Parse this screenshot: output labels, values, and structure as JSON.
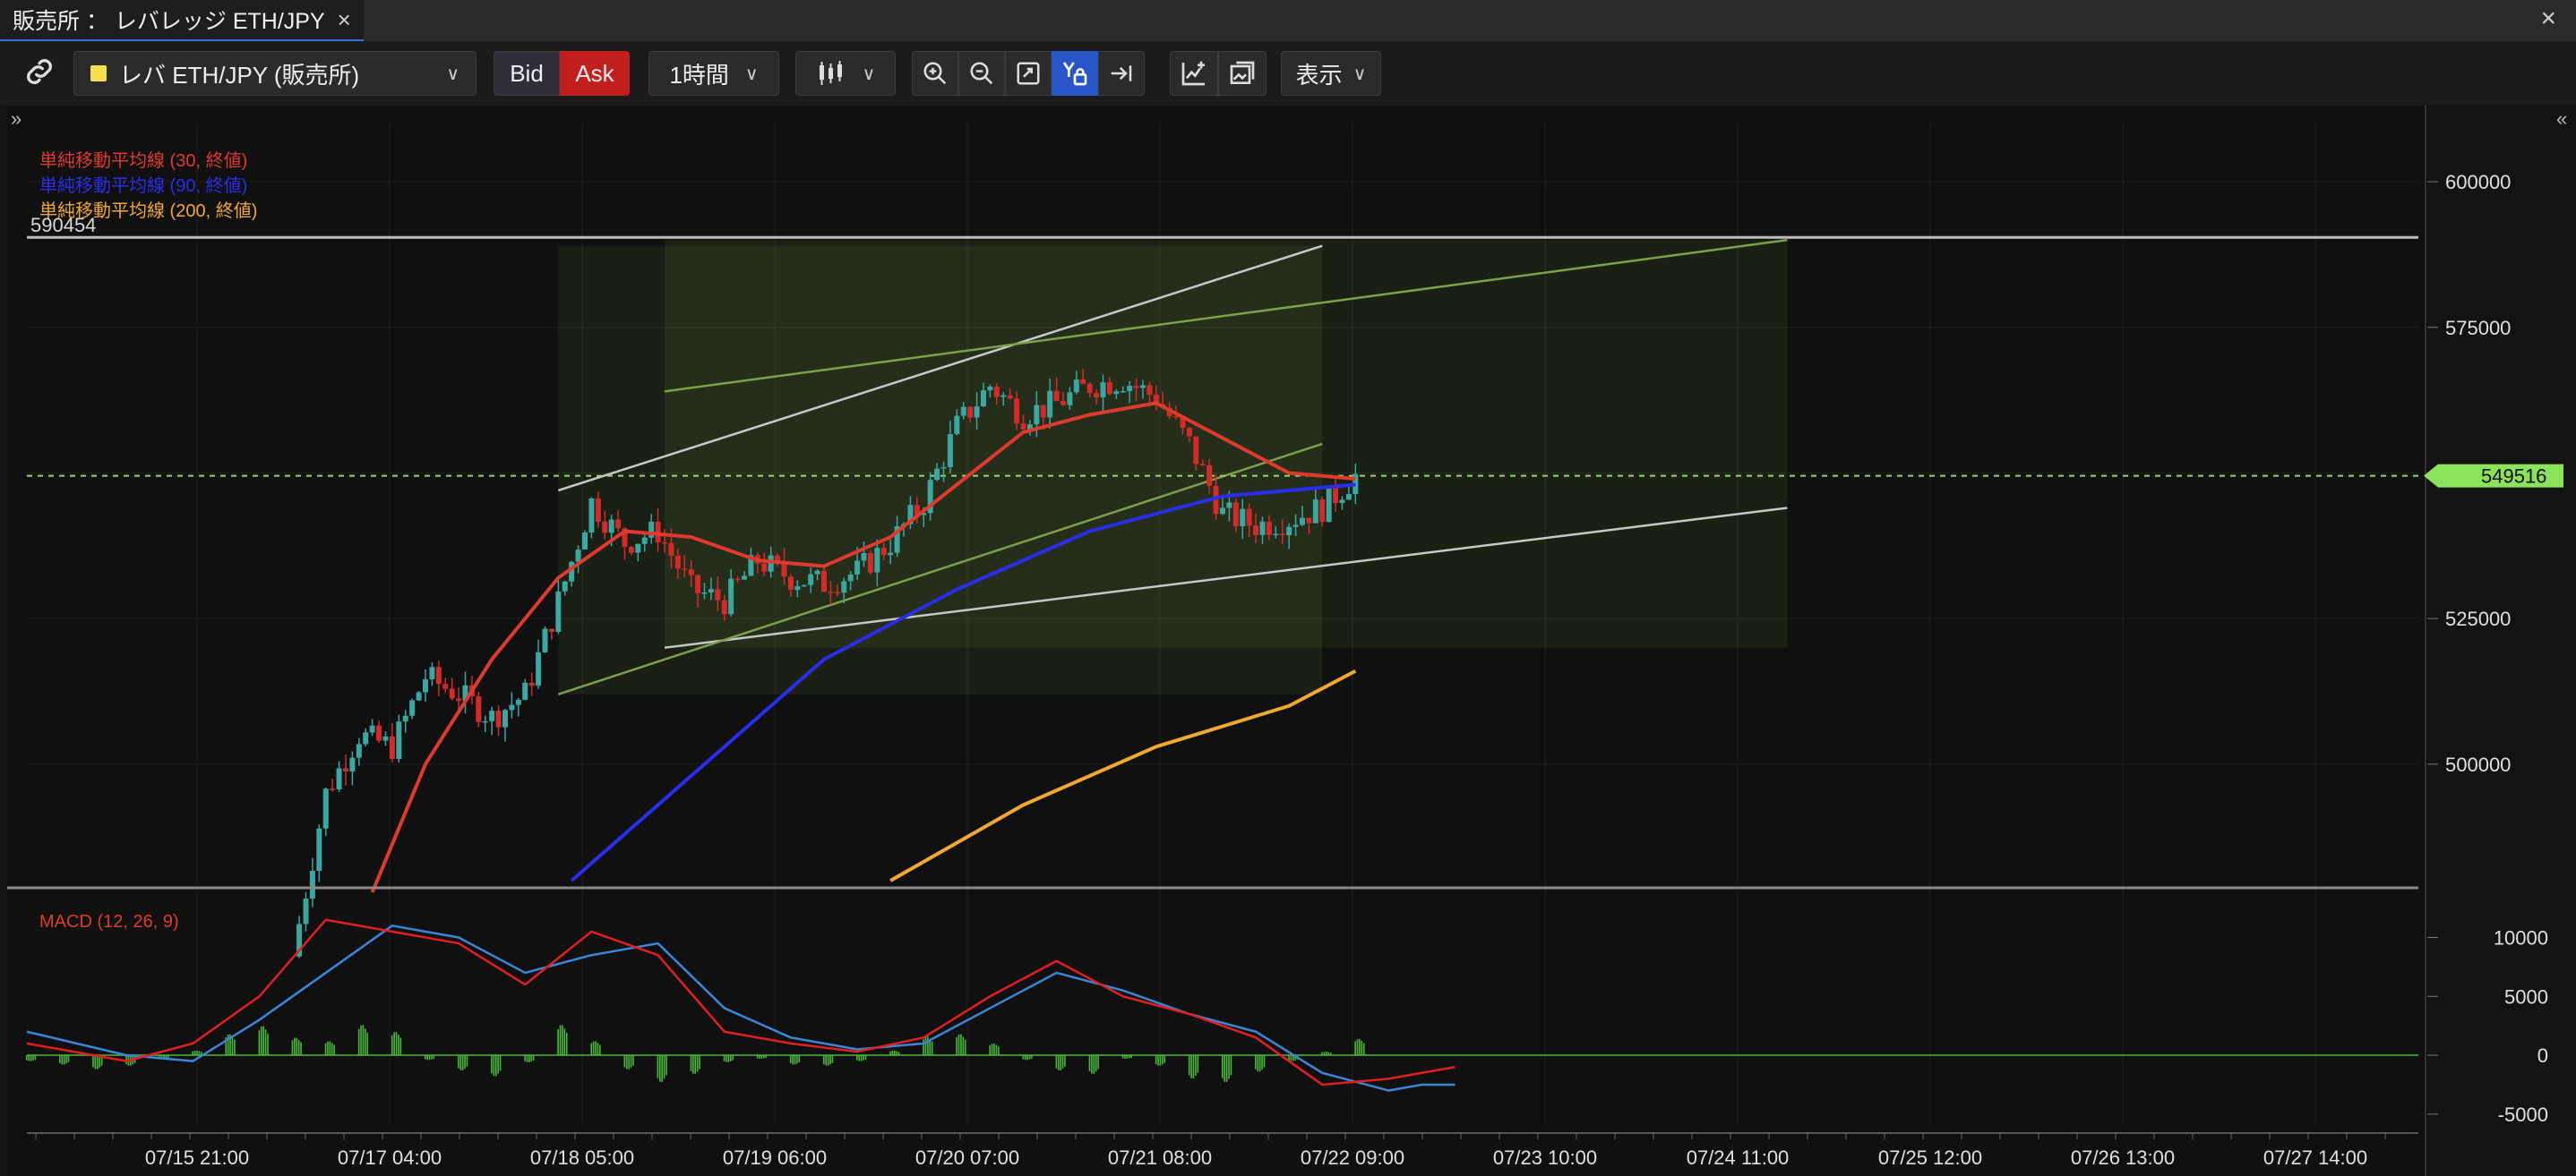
{
  "window": {
    "tab_title": "販売所 ： レバレッジ ETH/JPY",
    "tab_close": "×",
    "window_close": "×"
  },
  "toolbar": {
    "link_icon": "link-icon",
    "symbol_label": "レバ ETH/JPY (販売所)",
    "symbol_color": "#f5e050",
    "bid_label": "Bid",
    "ask_label": "Ask",
    "interval_label": "1時間",
    "chart_type_icon": "candlestick-icon",
    "zoom_in_icon": "zoom-in-icon",
    "zoom_out_icon": "zoom-out-icon",
    "fit_icon": "fit-screen-icon",
    "y_lock_icon": "y-lock-icon",
    "scroll_latest_icon": "scroll-to-latest-icon",
    "add_indicator_icon": "add-indicator-icon",
    "screenshot_icon": "screenshot-icon",
    "view_label": "表示",
    "left_expand": "»",
    "right_expand": "«"
  },
  "chart_data": [
    {
      "type": "candlestick",
      "legend": [
        {
          "name": "単純移動平均線 (30, 終値)",
          "color": "#e03a2f"
        },
        {
          "name": "単純移動平均線 (90, 終値)",
          "color": "#2a2ee8"
        },
        {
          "name": "単純移動平均線 (200, 終値)",
          "color": "#f0a830"
        }
      ],
      "yticks": [
        600000,
        575000,
        550000,
        525000,
        500000
      ],
      "ytick_labels": [
        "600000",
        "575000",
        "525000",
        "500000"
      ],
      "ylim": [
        480000,
        610000
      ],
      "xtick_labels": [
        "07/15 21:00",
        "07/17 04:00",
        "07/18 05:00",
        "07/19 06:00",
        "07/20 07:00",
        "07/21 08:00",
        "07/22 09:00",
        "07/23 10:00",
        "07/24 11:00",
        "07/25 12:00",
        "07/26 13:00",
        "07/27 14:00"
      ],
      "xlim": [
        0,
        360
      ],
      "last_price": 549516,
      "last_price_label": "549516",
      "hline_value": 590454,
      "hline_label": "590454",
      "last_candle_x": 200,
      "close_path": [
        [
          40,
          467000
        ],
        [
          45,
          495000
        ],
        [
          50,
          505000
        ],
        [
          55,
          503000
        ],
        [
          60,
          515000
        ],
        [
          65,
          512000
        ],
        [
          70,
          508000
        ],
        [
          75,
          512000
        ],
        [
          80,
          528000
        ],
        [
          85,
          545000
        ],
        [
          90,
          538000
        ],
        [
          95,
          540000
        ],
        [
          100,
          530000
        ],
        [
          105,
          528000
        ],
        [
          110,
          535000
        ],
        [
          115,
          532000
        ],
        [
          120,
          531000
        ],
        [
          125,
          533000
        ],
        [
          130,
          538000
        ],
        [
          135,
          545000
        ],
        [
          140,
          558000
        ],
        [
          145,
          565000
        ],
        [
          150,
          560000
        ],
        [
          155,
          562000
        ],
        [
          160,
          565000
        ],
        [
          165,
          566000
        ],
        [
          170,
          563000
        ],
        [
          175,
          555000
        ],
        [
          180,
          543000
        ],
        [
          185,
          541000
        ],
        [
          190,
          542000
        ],
        [
          195,
          544000
        ],
        [
          200,
          549516
        ]
      ],
      "sma30": [
        [
          52,
          478000
        ],
        [
          60,
          500000
        ],
        [
          70,
          518000
        ],
        [
          80,
          532000
        ],
        [
          90,
          540000
        ],
        [
          100,
          539000
        ],
        [
          110,
          535000
        ],
        [
          120,
          534000
        ],
        [
          130,
          539000
        ],
        [
          140,
          548000
        ],
        [
          150,
          557000
        ],
        [
          160,
          560000
        ],
        [
          170,
          562000
        ],
        [
          180,
          556000
        ],
        [
          190,
          550000
        ],
        [
          200,
          549000
        ]
      ],
      "sma90": [
        [
          82,
          480000
        ],
        [
          100,
          498000
        ],
        [
          120,
          518000
        ],
        [
          140,
          530000
        ],
        [
          160,
          540000
        ],
        [
          180,
          546000
        ],
        [
          200,
          548000
        ]
      ],
      "sma200": [
        [
          130,
          480000
        ],
        [
          150,
          493000
        ],
        [
          170,
          503000
        ],
        [
          190,
          510000
        ],
        [
          200,
          516000
        ]
      ],
      "channels": [
        {
          "color": "#c8c8c8",
          "points": [
            [
              80,
              547000
            ],
            [
              195,
              589000
            ]
          ]
        },
        {
          "color": "#c8c8c8",
          "points": [
            [
              96,
              520000
            ],
            [
              265,
              544000
            ]
          ]
        },
        {
          "color": "#7fa04a",
          "points": [
            [
              96,
              564000
            ],
            [
              265,
              590000
            ]
          ]
        },
        {
          "color": "#7fa04a",
          "points": [
            [
              80,
              512000
            ],
            [
              195,
              555000
            ]
          ]
        }
      ],
      "shaded_zones": [
        {
          "color": "#6f8f3a",
          "x": [
            80,
            195
          ],
          "y": [
            512000,
            589000
          ]
        },
        {
          "color": "#6f8f3a",
          "x": [
            96,
            265
          ],
          "y": [
            520000,
            590000
          ]
        }
      ]
    },
    {
      "type": "line",
      "title": "MACD (12, 26, 9)",
      "yticks": [
        10000,
        5000,
        0,
        -5000
      ],
      "ytick_labels": [
        "10000",
        "5000",
        "0",
        "-5000"
      ],
      "ylim": [
        -6000,
        13000
      ],
      "xlim": [
        0,
        360
      ],
      "series": [
        {
          "color": "#e02020",
          "points": [
            [
              0,
              1000
            ],
            [
              15,
              -500
            ],
            [
              25,
              1000
            ],
            [
              35,
              5000
            ],
            [
              45,
              11500
            ],
            [
              55,
              10500
            ],
            [
              65,
              9500
            ],
            [
              75,
              6000
            ],
            [
              85,
              10500
            ],
            [
              95,
              8500
            ],
            [
              105,
              2000
            ],
            [
              115,
              1000
            ],
            [
              125,
              300
            ],
            [
              135,
              1500
            ],
            [
              145,
              5000
            ],
            [
              155,
              8000
            ],
            [
              165,
              5000
            ],
            [
              175,
              3500
            ],
            [
              185,
              1500
            ],
            [
              195,
              -2500
            ],
            [
              205,
              -2000
            ],
            [
              210,
              -1500
            ],
            [
              215,
              -1000
            ]
          ]
        },
        {
          "color": "#3a86d8",
          "points": [
            [
              0,
              2000
            ],
            [
              15,
              0
            ],
            [
              25,
              -500
            ],
            [
              35,
              3000
            ],
            [
              45,
              7000
            ],
            [
              55,
              11000
            ],
            [
              65,
              10000
            ],
            [
              75,
              7000
            ],
            [
              85,
              8500
            ],
            [
              95,
              9500
            ],
            [
              105,
              4000
            ],
            [
              115,
              1500
            ],
            [
              125,
              500
            ],
            [
              135,
              1000
            ],
            [
              145,
              4000
            ],
            [
              155,
              7000
            ],
            [
              165,
              5500
            ],
            [
              175,
              3500
            ],
            [
              185,
              2000
            ],
            [
              195,
              -1500
            ],
            [
              205,
              -3000
            ],
            [
              210,
              -2500
            ],
            [
              215,
              -2500
            ]
          ]
        }
      ],
      "histogram": [
        [
          0,
          -500
        ],
        [
          5,
          -800
        ],
        [
          10,
          -1200
        ],
        [
          15,
          -900
        ],
        [
          20,
          -300
        ],
        [
          25,
          400
        ],
        [
          30,
          1800
        ],
        [
          35,
          2500
        ],
        [
          40,
          1500
        ],
        [
          45,
          1200
        ],
        [
          50,
          2600
        ],
        [
          55,
          2000
        ],
        [
          60,
          -400
        ],
        [
          65,
          -1300
        ],
        [
          70,
          -1800
        ],
        [
          75,
          -600
        ],
        [
          80,
          2600
        ],
        [
          85,
          1200
        ],
        [
          90,
          -1200
        ],
        [
          95,
          -2300
        ],
        [
          100,
          -1600
        ],
        [
          105,
          -600
        ],
        [
          110,
          -300
        ],
        [
          115,
          -800
        ],
        [
          120,
          -900
        ],
        [
          125,
          -500
        ],
        [
          130,
          400
        ],
        [
          135,
          1600
        ],
        [
          140,
          1800
        ],
        [
          145,
          1000
        ],
        [
          150,
          -400
        ],
        [
          155,
          -1300
        ],
        [
          160,
          -1600
        ],
        [
          165,
          -300
        ],
        [
          170,
          -900
        ],
        [
          175,
          -2000
        ],
        [
          180,
          -2300
        ],
        [
          185,
          -1400
        ],
        [
          190,
          -500
        ],
        [
          195,
          300
        ],
        [
          200,
          1400
        ]
      ]
    }
  ]
}
